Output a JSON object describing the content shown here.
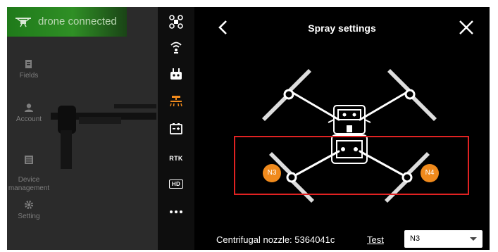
{
  "status": {
    "text": "drone connected",
    "icon": "drone-icon",
    "color": "#2f8f25"
  },
  "sidebar": {
    "items": [
      {
        "label": "Fields",
        "icon": "fields-icon"
      },
      {
        "label": "Account",
        "icon": "account-icon"
      },
      {
        "label": "Device\nmanagement",
        "icon": "device-icon"
      },
      {
        "label": "Setting",
        "icon": "gear-icon"
      }
    ]
  },
  "toolbar": {
    "items": [
      {
        "icon": "aircraft-icon"
      },
      {
        "icon": "signal-icon"
      },
      {
        "icon": "remote-controller-icon"
      },
      {
        "icon": "spray-icon",
        "active": true
      },
      {
        "icon": "battery-icon"
      },
      {
        "label": "RTK"
      },
      {
        "label": "HD"
      },
      {
        "icon": "more-icon"
      }
    ],
    "active_color": "#f08a1c"
  },
  "spray": {
    "title": "Spray settings",
    "badges": {
      "left": "N3",
      "right": "N4"
    },
    "badge_color": "#f08a1c",
    "highlight_color": "#e12222",
    "nozzle_label": "Centrifugal nozzle: 5364041c",
    "test_label": "Test",
    "select_value": "N3"
  }
}
